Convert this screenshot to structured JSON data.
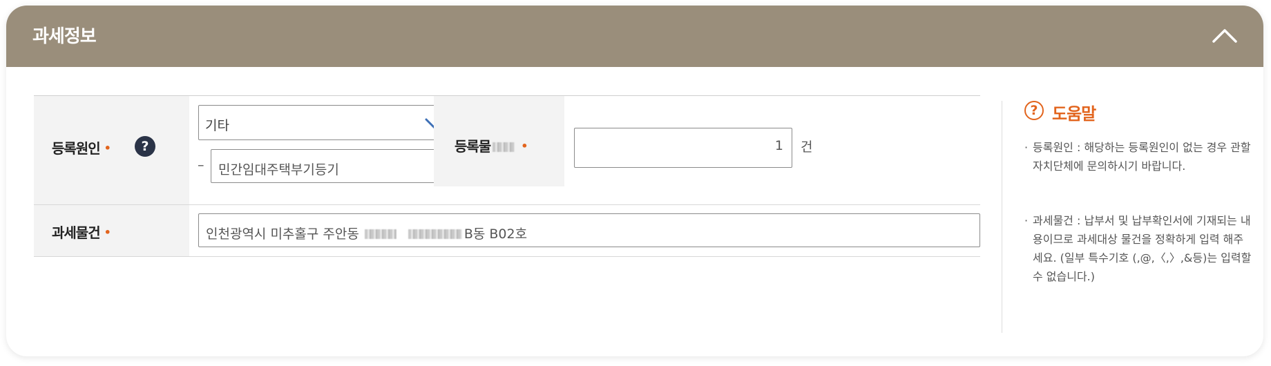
{
  "section": {
    "title": "과세정보"
  },
  "form": {
    "reg_cause": {
      "label": "등록원인",
      "required_mark": "•",
      "help_icon_text": "?",
      "select_value": "기타",
      "detail_dash": "–",
      "detail_value": "민간임대주택부기등기"
    },
    "reg_count": {
      "label": "등록물",
      "required_mark": "•",
      "value": "1",
      "unit": "건"
    },
    "tax_object": {
      "label": "과세물건",
      "required_mark": "•",
      "address_prefix": "인천광역시 미추홀구 주안동",
      "address_suffix": "B동 B02호"
    }
  },
  "help": {
    "icon_text": "?",
    "title": "도움말",
    "bullet": "·",
    "items": [
      {
        "text": "등록원인 : 해당하는 등록원인이 없는 경우 관할자치단체에 문의하시기 바랍니다."
      },
      {
        "text": "과세물건 : 납부서 및 납부확인서에 기재되는 내용이므로 과세대상 물건을 정확하게 입력 해주세요. (일부 특수기호 (,@,〈,〉,&등)는 입력할 수 없습니다.)"
      }
    ]
  },
  "colors": {
    "header_bg": "#9a8e7b",
    "accent": "#e2641d",
    "chevron": "#3d6fb6",
    "help_icon_bg": "#2a3347"
  },
  "icons": {
    "collapse": "chevron-up-icon",
    "select": "chevron-down-icon",
    "question": "question-circle-icon"
  }
}
